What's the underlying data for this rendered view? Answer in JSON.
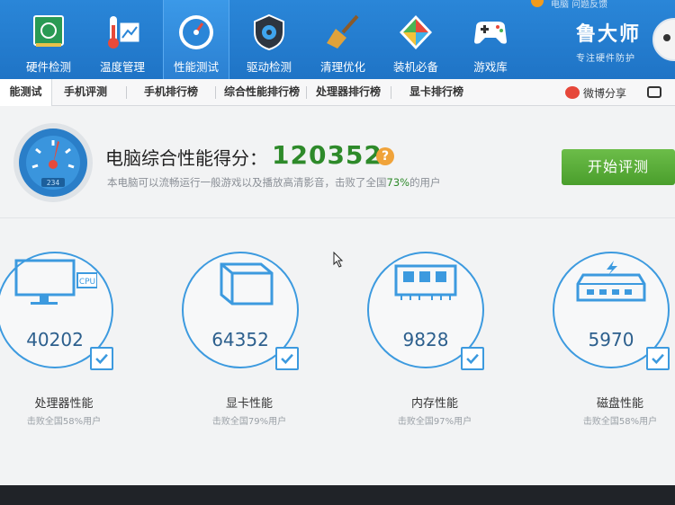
{
  "nav": {
    "items": [
      {
        "label": "硬件检测",
        "icon": "motherboard-icon"
      },
      {
        "label": "温度管理",
        "icon": "thermometer-icon"
      },
      {
        "label": "性能测试",
        "icon": "speedometer-icon"
      },
      {
        "label": "驱动检测",
        "icon": "gear-shield-icon"
      },
      {
        "label": "清理优化",
        "icon": "broom-icon"
      },
      {
        "label": "装机必备",
        "icon": "cube-icon"
      },
      {
        "label": "游戏库",
        "icon": "gamepad-icon"
      }
    ],
    "active_index": 2,
    "brand_name": "鲁大师",
    "brand_slogan": "专注硬件防护",
    "top_text": "电脑  问题反馈"
  },
  "tabs": {
    "items": [
      "能测试",
      "手机评测",
      "手机排行榜",
      "综合性能排行榜",
      "处理器排行榜",
      "显卡排行榜"
    ],
    "active_index": 0,
    "share_label": "微博分享",
    "camera_icon": "camera-icon"
  },
  "score": {
    "title": "电脑综合性能得分：",
    "value": "120352",
    "help": "?",
    "desc_prefix": "本电脑可以流畅运行一般游戏以及播放高清影音，击败了全国",
    "desc_percent": "73%",
    "desc_suffix": "的用户",
    "gauge_readout": "234",
    "start_button": "开始评测"
  },
  "metrics": [
    {
      "name": "处理器性能",
      "value": "40202",
      "sub": "击败全国58%用户",
      "icon": "cpu-monitor-icon",
      "icon_text": "CPU"
    },
    {
      "name": "显卡性能",
      "value": "64352",
      "sub": "击败全国79%用户",
      "icon": "graphics-cube-icon"
    },
    {
      "name": "内存性能",
      "value": "9828",
      "sub": "击败全国97%用户",
      "icon": "memory-chip-icon"
    },
    {
      "name": "磁盘性能",
      "value": "5970",
      "sub": "击败全国58%用户",
      "icon": "hard-disk-icon"
    }
  ],
  "colors": {
    "topbar": "#2280d0",
    "score_green": "#2e8a2a",
    "ring_blue": "#3c9adf",
    "button_green": "#5aad3a",
    "help_orange": "#f0a33a"
  }
}
